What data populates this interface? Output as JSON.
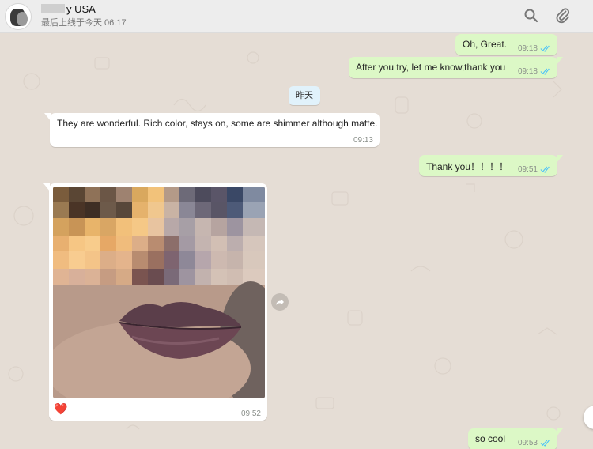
{
  "header": {
    "contact_name": "y USA",
    "last_seen": "最后上线于今天 06:17",
    "icons": [
      "search-icon",
      "paperclip-icon"
    ]
  },
  "date_divider": "昨天",
  "messages": [
    {
      "direction": "outgoing",
      "text": "Oh, Great.",
      "time": "09:18",
      "status": "read"
    },
    {
      "direction": "outgoing",
      "text": "After you try, let me know,thank you",
      "time": "09:18",
      "status": "read"
    },
    {
      "direction": "incoming",
      "text": "They are wonderful. Rich color, stays on, some are shimmer although matte.",
      "time": "09:13"
    },
    {
      "direction": "outgoing",
      "text": "Thank you！！！！",
      "time": "09:51",
      "status": "read"
    },
    {
      "direction": "incoming",
      "type": "image",
      "reaction": "❤️",
      "time": "09:52"
    },
    {
      "direction": "outgoing",
      "text": "so cool",
      "time": "09:53",
      "status": "read"
    }
  ],
  "colors": {
    "chat_bg": "#e5ddd5",
    "outgoing_bubble": "#dcf8c6",
    "incoming_bubble": "#ffffff",
    "read_ticks": "#4fc3f7",
    "header_bg": "#ededed"
  }
}
